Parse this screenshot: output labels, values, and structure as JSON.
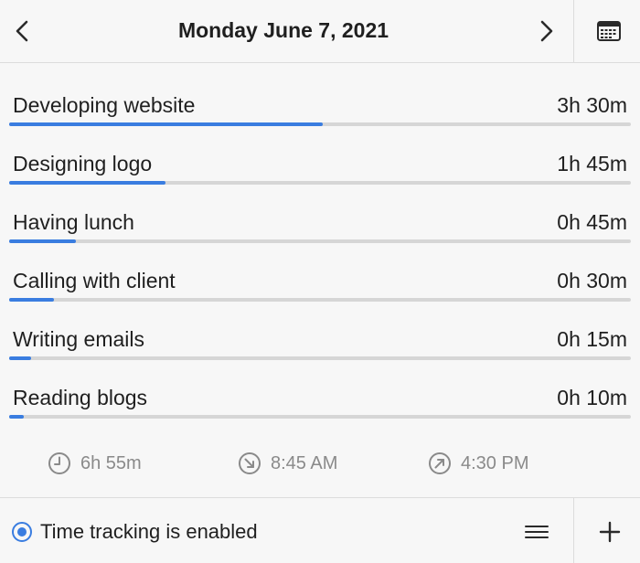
{
  "header": {
    "title": "Monday June 7, 2021",
    "prev_icon": "chevron-left-icon",
    "next_icon": "chevron-right-icon",
    "calendar_icon": "calendar-icon"
  },
  "activities": [
    {
      "name": "Developing website",
      "duration": "3h 30m",
      "progress": 0.504
    },
    {
      "name": "Designing logo",
      "duration": "1h 45m",
      "progress": 0.252
    },
    {
      "name": "Having lunch",
      "duration": "0h 45m",
      "progress": 0.108
    },
    {
      "name": "Calling with client",
      "duration": "0h 30m",
      "progress": 0.072
    },
    {
      "name": "Writing emails",
      "duration": "0h 15m",
      "progress": 0.036
    },
    {
      "name": "Reading blogs",
      "duration": "0h 10m",
      "progress": 0.024
    }
  ],
  "summary": {
    "total": "6h 55m",
    "start": "8:45 AM",
    "end": "4:30 PM",
    "total_icon": "clock-icon",
    "start_icon": "arrow-down-right-circle-icon",
    "end_icon": "arrow-up-right-circle-icon"
  },
  "footer": {
    "status_label": "Time tracking is enabled",
    "status_enabled": true,
    "status_icon": "radio-selected-icon",
    "menu_icon": "menu-icon",
    "add_icon": "plus-icon"
  },
  "colors": {
    "accent": "#3a7de0",
    "track": "#d6d6d6",
    "muted_text": "#8a8a8a",
    "background": "#f7f7f7"
  }
}
